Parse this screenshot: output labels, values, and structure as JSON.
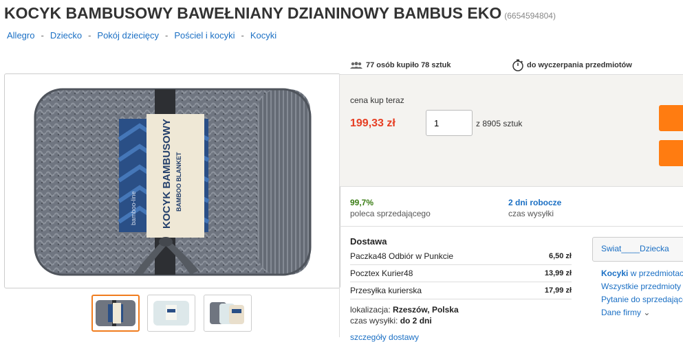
{
  "product": {
    "title": "KOCYK BAMBUSOWY BAWEŁNIANY DZIANINOWY BAMBUS EKO",
    "id": "(6654594804)"
  },
  "breadcrumb": [
    "Allegro",
    "Dziecko",
    "Pokój dziecięcy",
    "Pościel i kocyki",
    "Kocyki"
  ],
  "stats": {
    "buyers_text": "77 osób kupiło 78 sztuk",
    "stock_text": "do wyczerpania przedmiotów"
  },
  "image_label": {
    "line1": "KOCYK BAMBUSOWY",
    "line2": "BAMBOO BLANKET",
    "brand": "bamboo-line"
  },
  "buy": {
    "price_label": "cena kup teraz",
    "price": "199,33 zł",
    "quantity": "1",
    "quantity_of": "z 8905 sztuk"
  },
  "seller_stats": {
    "recommend_value": "99,7%",
    "recommend_label": "poleca sprzedającego",
    "shipping_value": "2 dni robocze",
    "shipping_label": "czas wysyłki"
  },
  "delivery": {
    "header": "Dostawa",
    "options": [
      {
        "name": "Paczka48 Odbiór w Punkcie",
        "price": "6,50 zł"
      },
      {
        "name": "Pocztex Kurier48",
        "price": "13,99 zł"
      },
      {
        "name": "Przesyłka kurierska",
        "price": "17,99 zł"
      }
    ],
    "location_label": "lokalizacja:",
    "location": "Rzeszów, Polska",
    "time_label": "czas wysyłki:",
    "time": "do 2 dni",
    "details_link": "szczegóły dostawy"
  },
  "seller": {
    "name": "Swiat____Dziecka",
    "link1_bold": "Kocyki",
    "link1_rest": " w przedmiotach",
    "link2": "Wszystkie przedmioty",
    "link3": "Pytanie do sprzedającego",
    "link4": "Dane firmy"
  },
  "colors": {
    "price": "#e63e23",
    "link": "#1a6fc4",
    "accent_orange": "#ff7c11",
    "recommend_green": "#3a7d14"
  }
}
